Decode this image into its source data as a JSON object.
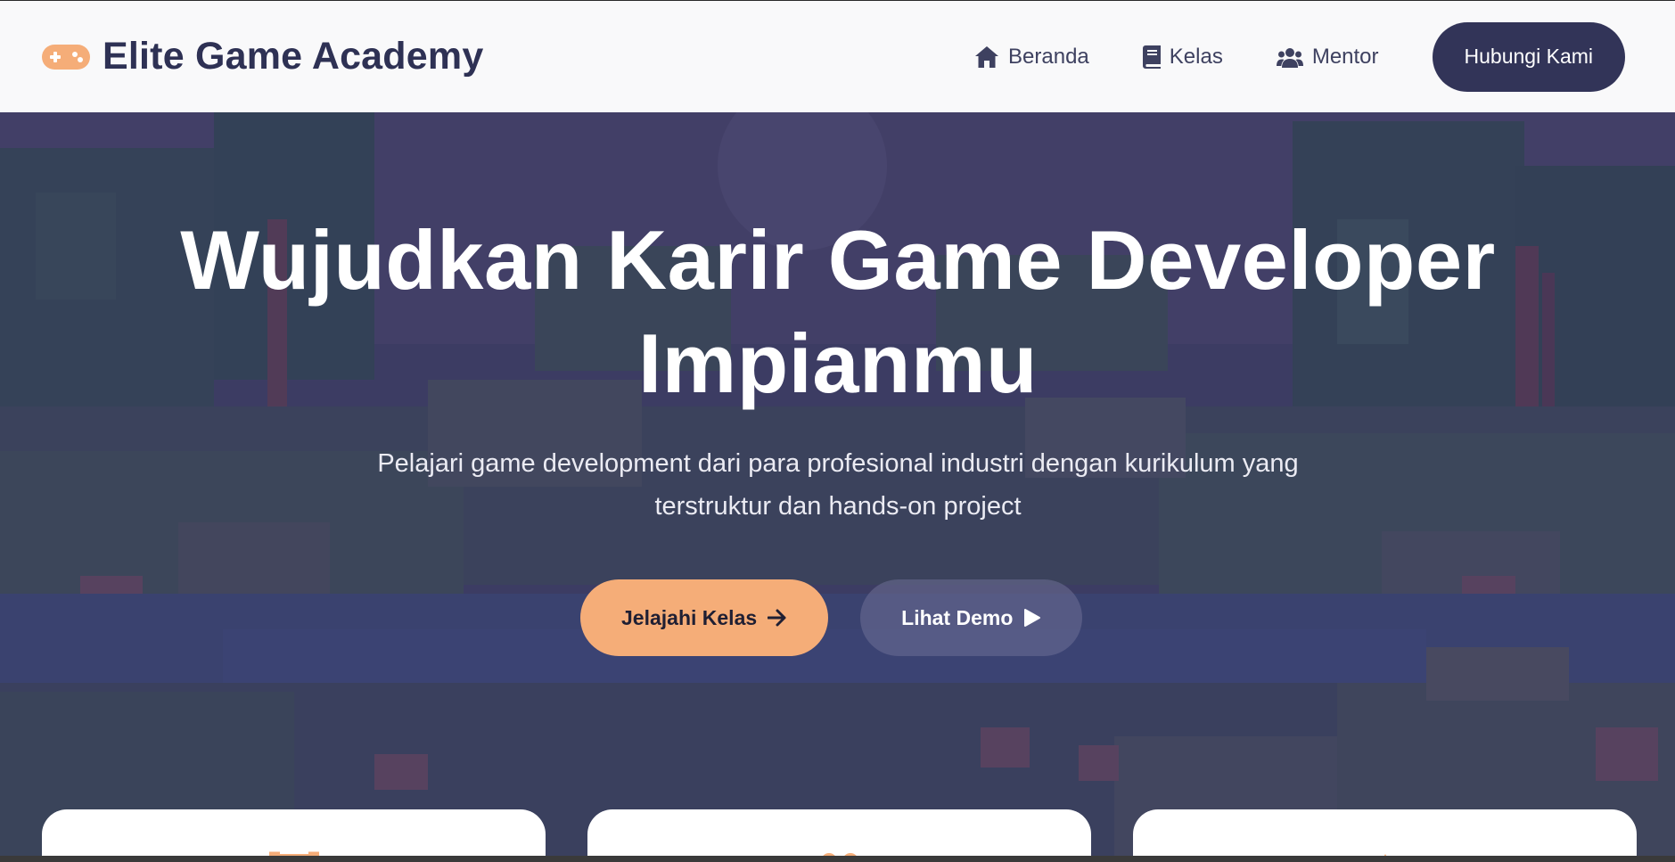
{
  "brand": {
    "icon": "gamepad-icon",
    "name": "Elite Game Academy",
    "accent": "#f5ad78",
    "primary": "#2e3154"
  },
  "nav": {
    "items": [
      {
        "icon": "home-icon",
        "label": "Beranda"
      },
      {
        "icon": "book-icon",
        "label": "Kelas"
      },
      {
        "icon": "users-icon",
        "label": "Mentor"
      }
    ],
    "contact_label": "Hubungi Kami"
  },
  "hero": {
    "title_line1": "Wujudkan Karir Game Developer",
    "title_line2": "Impianmu",
    "subtitle_line1": "Pelajari game development dari para profesional industri dengan kurikulum yang",
    "subtitle_line2": "terstruktur dan hands-on project",
    "primary_cta": {
      "label": "Jelajahi Kelas",
      "icon": "arrow-right-icon"
    },
    "secondary_cta": {
      "label": "Lihat Demo",
      "icon": "play-icon"
    }
  },
  "feature_cards": [
    {
      "icon": "trophy-icon"
    },
    {
      "icon": "users-icon"
    },
    {
      "icon": "rocket-icon"
    }
  ]
}
